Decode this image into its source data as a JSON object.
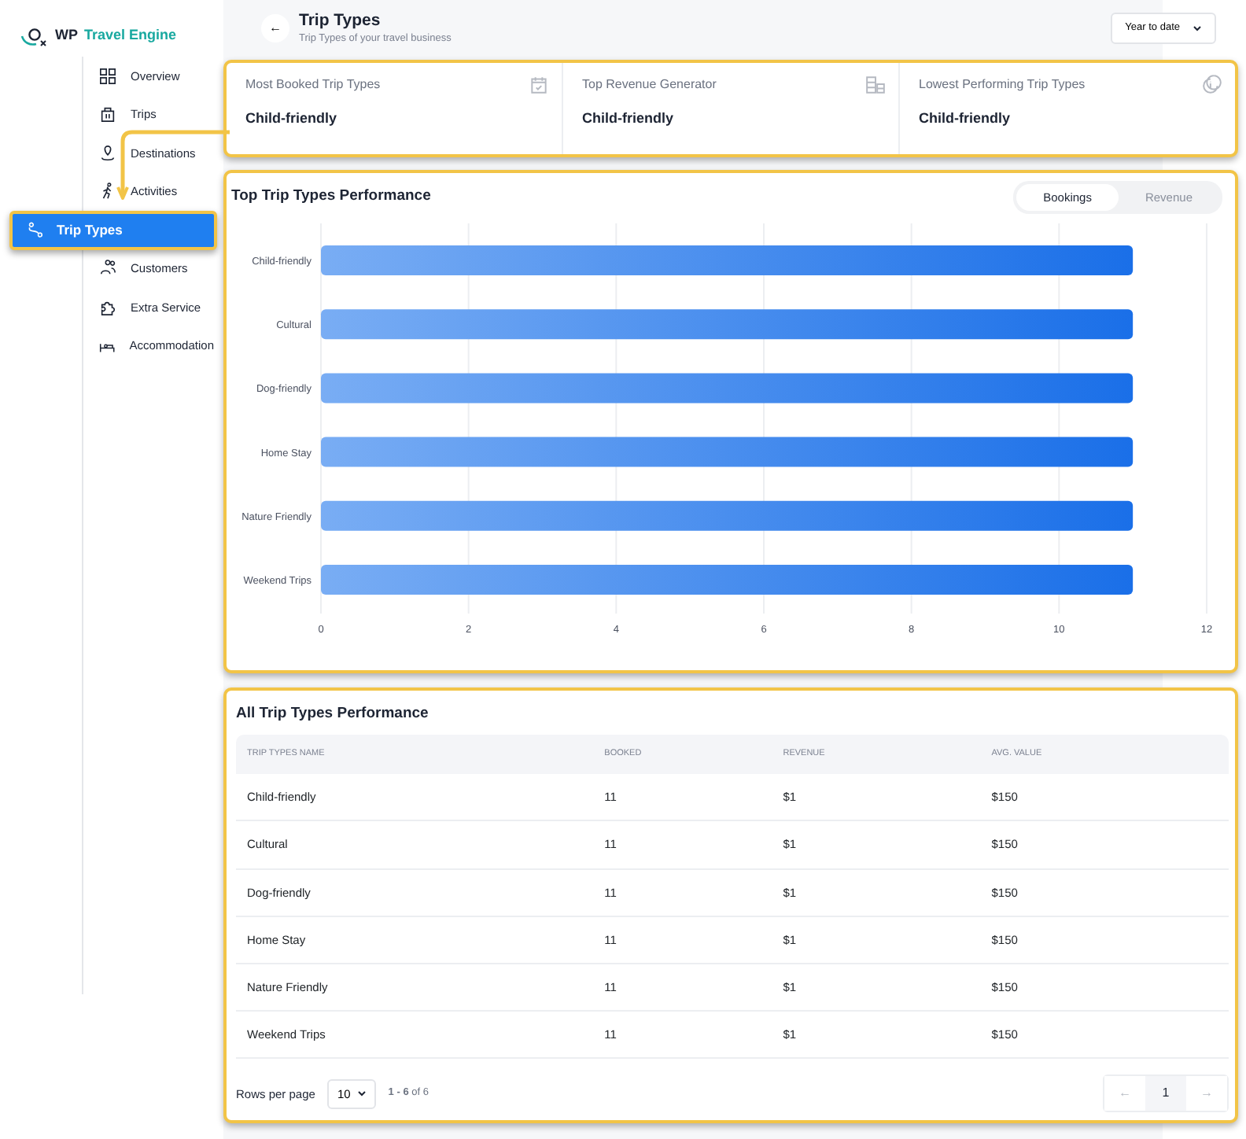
{
  "logo": {
    "prefix": "WP",
    "accent": "Travel Engine"
  },
  "sidebar": {
    "items": [
      {
        "label": "Overview",
        "selected": false
      },
      {
        "label": "Trips",
        "selected": false
      },
      {
        "label": "Destinations",
        "selected": false
      },
      {
        "label": "Activities",
        "selected": false
      },
      {
        "label": "Trip Types",
        "selected": true
      },
      {
        "label": "Customers",
        "selected": false
      },
      {
        "label": "Extra Service",
        "selected": false
      },
      {
        "label": "Accommodation",
        "selected": false
      }
    ]
  },
  "header": {
    "back": "←",
    "title": "Trip Types",
    "subtitle": "Trip Types of your travel business",
    "period": "Year to date"
  },
  "stats": [
    {
      "label": "Most Booked Trip Types",
      "value": "Child-friendly"
    },
    {
      "label": "Top Revenue Generator",
      "value": "Child-friendly"
    },
    {
      "label": "Lowest Performing Trip Types",
      "value": "Child-friendly"
    }
  ],
  "chart_card": {
    "title": "Top Trip Types Performance",
    "toggle": [
      {
        "label": "Bookings",
        "selected": true
      },
      {
        "label": "Revenue",
        "selected": false
      }
    ],
    "chart_data": {
      "type": "bar",
      "orientation": "horizontal",
      "grid": true,
      "categories": [
        "Child-friendly",
        "Cultural",
        "Dog-friendly",
        "Home Stay",
        "Nature Friendly",
        "Weekend Trips"
      ],
      "series": [
        {
          "color": "#1a6fe8",
          "values": [
            11,
            11,
            11,
            11,
            11,
            11
          ]
        }
      ],
      "xlim": [
        0,
        12
      ],
      "xticks": [
        0,
        2,
        4,
        6,
        8,
        10,
        12
      ]
    }
  },
  "table": {
    "title": "All Trip Types Performance",
    "columns": [
      "TRIP TYPES NAME",
      "BOOKED",
      "REVENUE",
      "AVG. VALUE"
    ],
    "rows": [
      [
        "Child-friendly",
        "11",
        "$1",
        "$150"
      ],
      [
        "Cultural",
        "11",
        "$1",
        "$150"
      ],
      [
        "Dog-friendly",
        "11",
        "$1",
        "$150"
      ],
      [
        "Home Stay",
        "11",
        "$1",
        "$150"
      ],
      [
        "Nature Friendly",
        "11",
        "$1",
        "$150"
      ],
      [
        "Weekend Trips",
        "11",
        "$1",
        "$150"
      ]
    ],
    "rows_per_page_label": "Rows per page",
    "rows_per_page": "10",
    "range": "1 - 6",
    "range_of": "of 6",
    "pages": [
      {
        "label": "1",
        "selected": true
      }
    ],
    "prev": "←",
    "next": "→"
  }
}
